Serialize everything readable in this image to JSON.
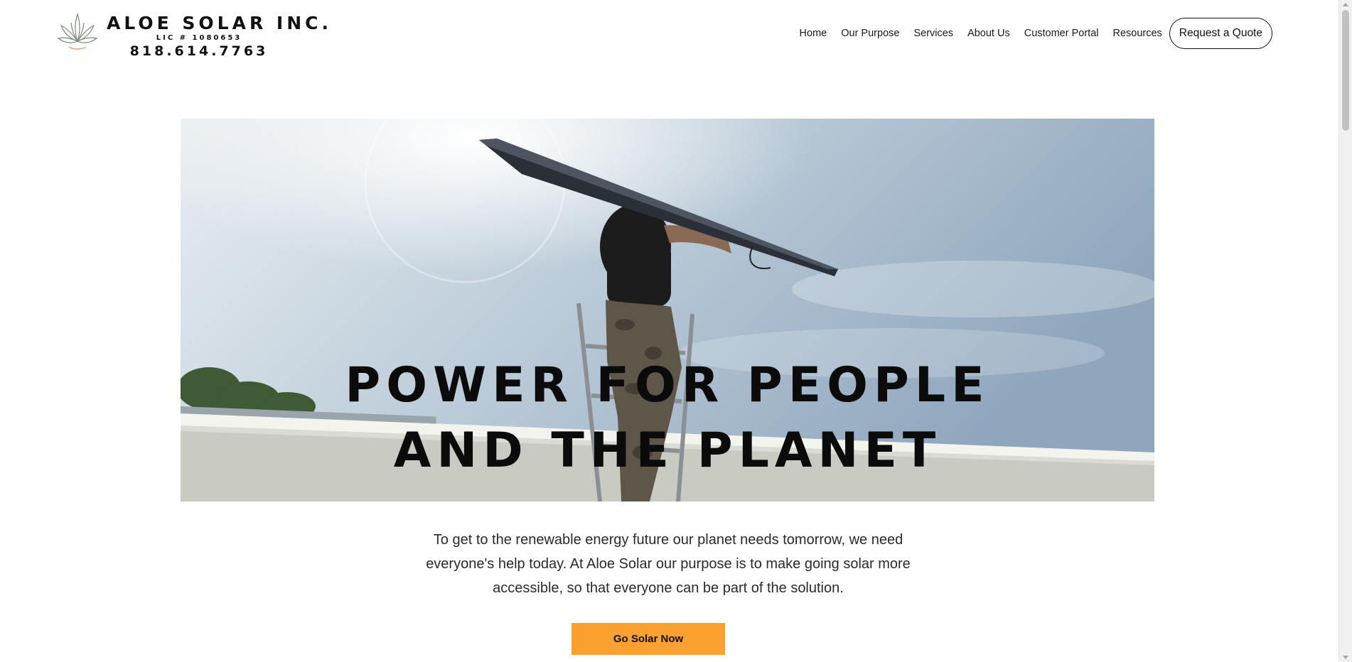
{
  "header": {
    "logo_icon": "aloe-plant-icon",
    "brand_name": "ALOE SOLAR INC.",
    "license": "LIC # 1080653",
    "phone": "818.614.7763"
  },
  "nav": {
    "items": [
      {
        "label": "Home"
      },
      {
        "label": "Our Purpose"
      },
      {
        "label": "Services"
      },
      {
        "label": "About Us"
      },
      {
        "label": "Customer Portal"
      },
      {
        "label": "Resources"
      }
    ],
    "quote_button": "Request a Quote"
  },
  "hero": {
    "line1": "POWER FOR PEOPLE",
    "line2": "AND THE PLANET"
  },
  "intro": {
    "text": "To get to the renewable energy future our planet needs tomorrow, we need everyone's help today. At Aloe Solar our purpose is to make going solar more accessible, so that everyone can be part of the solution."
  },
  "cta": {
    "label": "Go Solar Now"
  },
  "colors": {
    "accent": "#fba131",
    "text": "#111111"
  }
}
